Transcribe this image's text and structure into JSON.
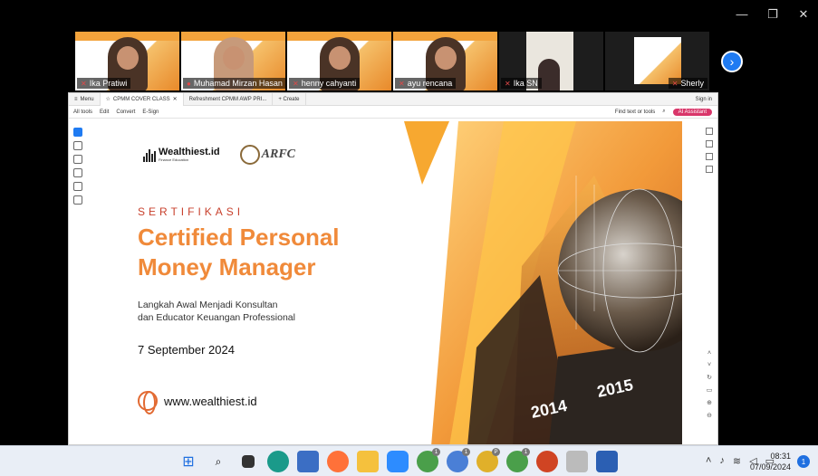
{
  "window": {
    "minimize": "—",
    "maximize": "❐",
    "close": "✕"
  },
  "participants": [
    {
      "name": "Ika Pratiwi"
    },
    {
      "name": "Muhamad Mirzan Hasan"
    },
    {
      "name": "henny cahyanti"
    },
    {
      "name": "ayu rencana"
    },
    {
      "name": "Ika SN"
    },
    {
      "name": "Sherly"
    }
  ],
  "next_page_icon": "›",
  "viewer": {
    "tabs": [
      "Menu",
      "CPMM COVER CLASS",
      "Refreshment CPMM AWP PRI...",
      "+ Create"
    ],
    "sign_in": "Sign in",
    "toolbar": {
      "all_tools": "All tools",
      "edit": "Edit",
      "convert": "Convert",
      "esign": "E-Sign",
      "find": "Find text or tools",
      "ai": "AI Assistant"
    }
  },
  "certificate": {
    "brand1": "Wealthiest.id",
    "brand1_sub": "Finance Education",
    "brand2": "ARFC",
    "kicker": "SERTIFIKASI",
    "title_line1": "Certified Personal",
    "title_line2": "Money Manager",
    "subtitle_line1": "Langkah Awal Menjadi Konsultan",
    "subtitle_line2": "dan Educator Keuangan Professional",
    "date": "7 September 2024",
    "website": "www.wealthiest.id",
    "year1": "2014",
    "year2": "2015",
    "colors": {
      "accent": "#f08a3a",
      "kicker": "#c8402c"
    }
  },
  "taskbar": {
    "time": "08:31",
    "date": "07/09/2024",
    "notifications": "1",
    "badges": [
      "1",
      "1",
      "P",
      "1"
    ]
  }
}
